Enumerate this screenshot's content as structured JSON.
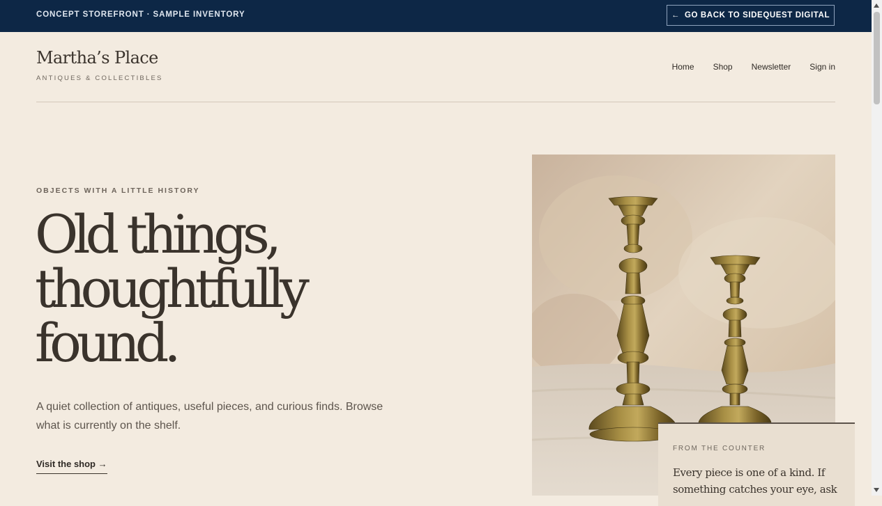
{
  "topbar": {
    "label": "CONCEPT STOREFRONT · SAMPLE INVENTORY",
    "back_icon": "←",
    "back_label": "GO BACK TO SIDEQUEST DIGITAL"
  },
  "brand": {
    "name": "Martha’s Place",
    "tagline": "ANTIQUES & COLLECTIBLES"
  },
  "nav": {
    "items": [
      "Home",
      "Shop",
      "Newsletter",
      "Sign in"
    ]
  },
  "hero": {
    "eyebrow": "OBJECTS WITH A LITTLE HISTORY",
    "headline": [
      "Old things,",
      "thoughtfully",
      "found."
    ],
    "intro": "A quiet collection of antiques, useful pieces, and curious finds. Browse what is currently on the shelf.",
    "cta": "Visit the shop →"
  },
  "counter_card": {
    "label": "FROM THE COUNTER",
    "text": "Every piece is one of a kind. If something catches your eye, ask"
  },
  "colors": {
    "topbar_bg": "#0d2746",
    "page_bg": "#f3ebe0",
    "text_dark": "#3a332c",
    "card_bg": "#e9dfd1",
    "brass": "#8a7434"
  }
}
